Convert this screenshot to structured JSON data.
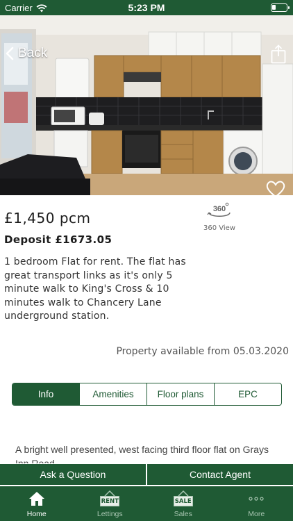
{
  "status_bar": {
    "carrier": "Carrier",
    "time": "5:23 PM"
  },
  "nav": {
    "back_label": "Back"
  },
  "listing": {
    "price": "£1,450 pcm",
    "deposit": "Deposit £1673.05",
    "view360_label": "360 View",
    "description": "1 bedroom Flat for rent. The flat has great transport links as it's only 5 minute walk to King's Cross & 10 minutes walk to Chancery Lane underground station.",
    "available": "Property available from 05.03.2020"
  },
  "tabs": [
    {
      "label": "Info",
      "active": true
    },
    {
      "label": "Amenities",
      "active": false
    },
    {
      "label": "Floor plans",
      "active": false
    },
    {
      "label": "EPC",
      "active": false
    }
  ],
  "info_text": "A bright well presented, west facing third floor flat on Grays Inn Road",
  "actions": {
    "ask": "Ask a Question",
    "contact": "Contact Agent"
  },
  "tabbar": [
    {
      "label": "Home",
      "icon": "home-icon",
      "active": true
    },
    {
      "label": "Lettings",
      "icon": "rent-sign-icon",
      "badge": "RENT",
      "active": false
    },
    {
      "label": "Sales",
      "icon": "sale-sign-icon",
      "badge": "SALE",
      "active": false
    },
    {
      "label": "More",
      "icon": "more-dots-icon",
      "active": false
    }
  ],
  "colors": {
    "brand_green": "#1f5a34",
    "inactive_tab_label": "#a9c6b2"
  }
}
